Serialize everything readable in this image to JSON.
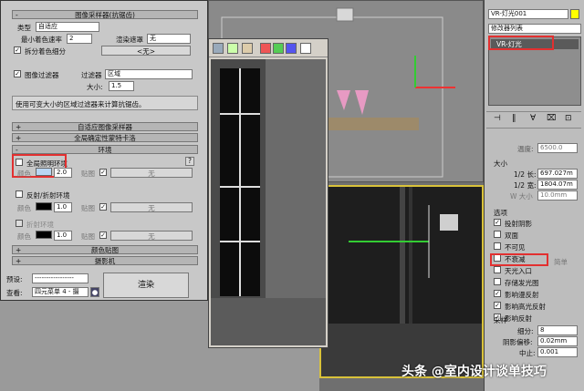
{
  "dialog": {
    "header": "图像采样器(抗锯齿)",
    "type_label": "类型",
    "type_value": "自适应",
    "min_rate_label": "最小着色速率",
    "min_rate_value": "2",
    "render_mask_label": "渲染遮罩",
    "render_mask_value": "无",
    "split_color_label": "拆分着色细分",
    "none_placeholder": "<无>",
    "image_filter_label": "图像过滤器",
    "filter_label": "过滤器",
    "filter_value": "区域",
    "size_label": "大小:",
    "size_value": "1.5",
    "hint_text": "使用可变大小的区域过滤器来计算抗锯齿。",
    "rollout_adaptive": "自适应图像采样器",
    "rollout_global_dmc": "全局确定性蒙特卡洛",
    "env_section": "环境",
    "gi_env_label": "全局照明环境",
    "color_label": "颜色",
    "gi_value": "2.0",
    "map_label": "贴图",
    "none": "无",
    "refl_env_label": "反射/折射环境",
    "refl_value": "1.0",
    "refr_env_label": "折射环境",
    "refr_value": "1.0",
    "rollout_color_mapping": "颜色贴图",
    "rollout_camera": "摄影机",
    "preset_label": "预设:",
    "preset_value": "-----------------",
    "view_label": "查看:",
    "view_value": "四元菜单 4 - 摄",
    "render_button": "渲染",
    "help_label": "?"
  },
  "right_panel": {
    "object_name": "VR-灯光001",
    "modifier_list": "修改器列表",
    "stack_item": "VR-灯光",
    "temperature_label": "温度:",
    "temperature_value": "6500.0",
    "size_group": "大小",
    "half_length_label": "1/2 长:",
    "half_length_value": "697.027m",
    "half_width_label": "1/2 宽:",
    "half_width_value": "1804.07m",
    "w_size_label": "W 大小",
    "w_size_value": "10.0mm",
    "options_group": "选项",
    "options": [
      {
        "label": "投射阴影",
        "checked": true
      },
      {
        "label": "双面",
        "checked": false
      },
      {
        "label": "不可见",
        "checked": false
      },
      {
        "label": "不衰减",
        "checked": false
      },
      {
        "label": "天光入口",
        "checked": false
      },
      {
        "label": "存储发光图",
        "checked": false
      },
      {
        "label": "影响漫反射",
        "checked": true
      },
      {
        "label": "影响高光反射",
        "checked": true
      },
      {
        "label": "影响反射",
        "checked": true
      }
    ],
    "simple_label": "简单",
    "sampling_group": "采样",
    "subdivs_label": "细分:",
    "subdivs_value": "8",
    "shadow_bias_label": "阴影偏移:",
    "shadow_bias_value": "0.02mm",
    "cutoff_label": "中止:",
    "cutoff_value": "0.001"
  },
  "watermark": "头条 @室内设计谈单技巧"
}
